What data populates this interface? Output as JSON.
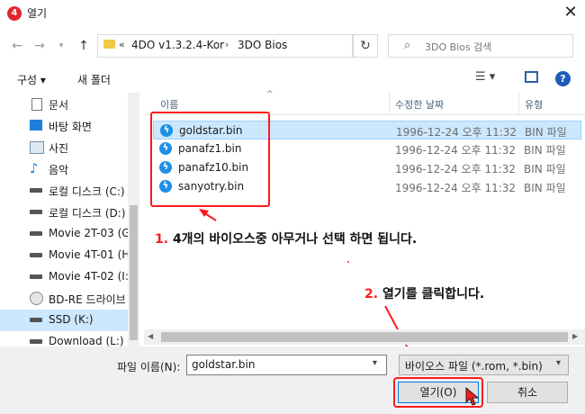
{
  "window": {
    "title": "열기",
    "app_icon": "4"
  },
  "nav": {
    "crumb_more": "«",
    "crumbs": [
      "4DO v1.3.2.4-Kor",
      "3DO Bios"
    ],
    "search_placeholder": "3DO Bios 검색"
  },
  "toolbar": {
    "organize": "구성 ▾",
    "new_folder": "새 폴더"
  },
  "sidebar": {
    "items": [
      {
        "label": "문서",
        "icon": "document-icon"
      },
      {
        "label": "바탕 화면",
        "icon": "desktop-icon"
      },
      {
        "label": "사진",
        "icon": "pictures-icon"
      },
      {
        "label": "음악",
        "icon": "music-icon"
      },
      {
        "label": "로컬 디스크 (C:)",
        "icon": "system-drive-icon"
      },
      {
        "label": "로컬 디스크 (D:)",
        "icon": "drive-icon"
      },
      {
        "label": "Movie 2T-03 (G",
        "icon": "drive-icon"
      },
      {
        "label": "Movie 4T-01 (H",
        "icon": "drive-icon"
      },
      {
        "label": "Movie 4T-02 (I:)",
        "icon": "drive-icon"
      },
      {
        "label": "BD-RE 드라이브",
        "icon": "disc-drive-icon"
      },
      {
        "label": "SSD (K:)",
        "icon": "drive-icon",
        "selected": true
      },
      {
        "label": "Download (L:)",
        "icon": "drive-icon"
      }
    ]
  },
  "columns": {
    "name": "이름",
    "modified": "수정한 날짜",
    "type": "유형"
  },
  "files": [
    {
      "name": "goldstar.bin",
      "date": "1996-12-24 오후 11:32",
      "type": "BIN 파일",
      "selected": true
    },
    {
      "name": "panafz1.bin",
      "date": "1996-12-24 오후 11:32",
      "type": "BIN 파일"
    },
    {
      "name": "panafz10.bin",
      "date": "1996-12-24 오후 11:32",
      "type": "BIN 파일"
    },
    {
      "name": "sanyotry.bin",
      "date": "1996-12-24 오후 11:32",
      "type": "BIN 파일"
    }
  ],
  "annotations": {
    "step1_num": "1.",
    "step1_text": "4개의 바이오스중 아무거나 선택 하면 됩니다.",
    "step2_num": "2.",
    "step2_text": "열기를 클릭합니다."
  },
  "bottom": {
    "filename_label": "파일 이름(N):",
    "filename_value": "goldstar.bin",
    "filetype_value": "바이오스 파일 (*.rom, *.bin)",
    "open_label": "열기(O)",
    "cancel_label": "취소"
  },
  "colors": {
    "selection": "#cce8ff",
    "annotation_red": "#ff1a1a",
    "accent": "#0078d7"
  }
}
